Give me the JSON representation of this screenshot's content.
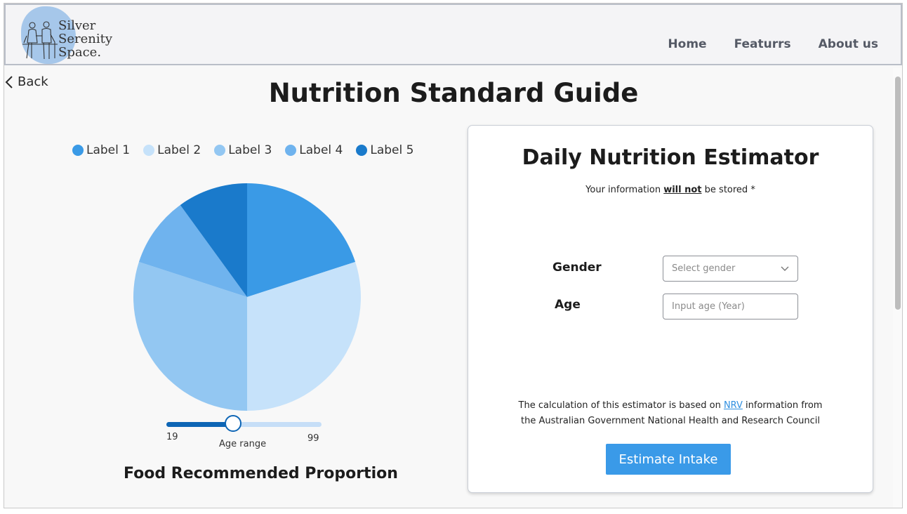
{
  "logo": {
    "line1": "Silver",
    "line2": "Serenity",
    "line3": "Space."
  },
  "nav": {
    "home": "Home",
    "features": "Featurrs",
    "about": "About us"
  },
  "back_label": "Back",
  "page_title": "Nutrition Standard Guide",
  "chart_data": {
    "type": "pie",
    "title": "Food Recommended Proportion",
    "labels": [
      "Label 1",
      "Label 2",
      "Label 3",
      "Label 4",
      "Label 5"
    ],
    "values": [
      20,
      30,
      30,
      10,
      10
    ],
    "colors": [
      "#3a9ae6",
      "#c6e2fa",
      "#93c7f2",
      "#6fb3ee",
      "#1a7acb"
    ],
    "legend_position": "top"
  },
  "slider": {
    "min_label": "19",
    "max_label": "99",
    "label": "Age range",
    "value_fraction": 0.43
  },
  "estimator": {
    "title": "Daily Nutrition Estimator",
    "privacy_prefix": "Your information",
    "privacy_emphasis": "will not",
    "privacy_suffix": "be stored *",
    "gender_label": "Gender",
    "gender_placeholder": "Select gender",
    "age_label": "Age",
    "age_placeholder": "Input age (Year)",
    "info_prefix": "The calculation of this estimator is based on",
    "info_link": "NRV",
    "info_suffix": "information from",
    "info_line2": "the Australian Government National Health and Research Council",
    "button_label": "Estimate Intake"
  },
  "colors": {
    "accent": "#3a9ae8",
    "slider_fill": "#0d65b5",
    "slider_track": "#c6def7"
  }
}
